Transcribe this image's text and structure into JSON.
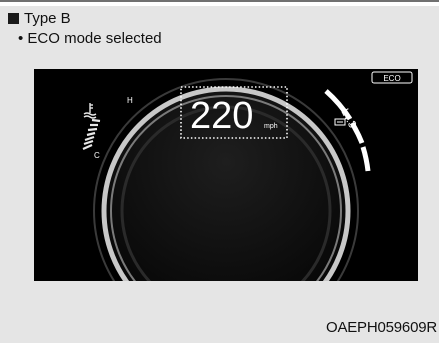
{
  "section": {
    "type_label": "Type B",
    "bullet_text": "• ECO mode selected"
  },
  "cluster": {
    "speed": "220",
    "speed_unit": "mph",
    "drive_mode_badge": "ECO",
    "temp_hot_label": "H",
    "temp_cold_label": "C",
    "level_label": "Lv.3"
  },
  "figure_code": "OAEPH059609R",
  "colors": {
    "background": "#e5e5e5",
    "panel": "#000000",
    "gauge_ring": "#bfbfbf",
    "text_on_panel": "#ffffff",
    "highlight_dots": "#ffffff"
  }
}
